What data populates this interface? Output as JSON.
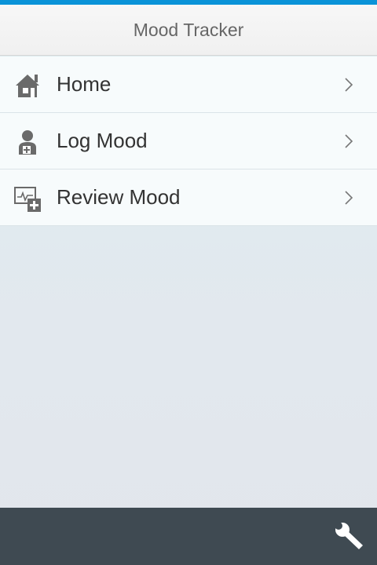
{
  "header": {
    "title": "Mood Tracker"
  },
  "menu": {
    "items": [
      {
        "label": "Home",
        "icon": "home-icon"
      },
      {
        "label": "Log Mood",
        "icon": "doctor-icon"
      },
      {
        "label": "Review Mood",
        "icon": "monitor-chart-add-icon"
      }
    ]
  },
  "footer": {
    "settings_icon": "wrench-icon"
  },
  "colors": {
    "accent": "#0a93d8",
    "header_bg": "#f3f3f3",
    "footer_bg": "#3f4a52",
    "text": "#333333",
    "icon": "#6a6a6a"
  }
}
